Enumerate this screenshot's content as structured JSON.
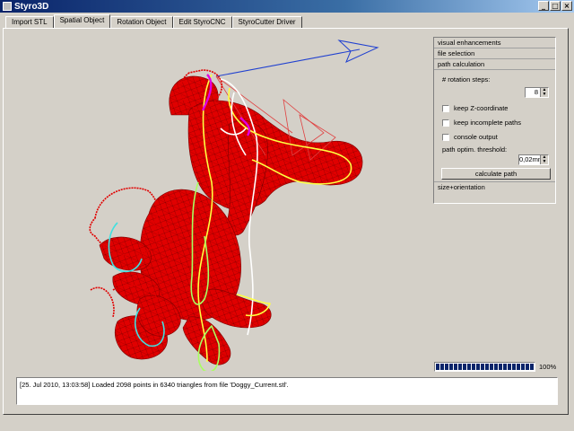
{
  "window": {
    "title": "Styro3D",
    "buttons": {
      "minimize": "_",
      "maximize": "□",
      "close": "×"
    }
  },
  "tabs": [
    {
      "label": "Import STL",
      "active": false
    },
    {
      "label": "Spatial Object",
      "active": true
    },
    {
      "label": "Rotation Object",
      "active": false
    },
    {
      "label": "Edit StyroCNC",
      "active": false
    },
    {
      "label": "StyroCutter Driver",
      "active": false
    }
  ],
  "viewport": {
    "description_icon": "3d-model-viewport",
    "colors": {
      "mesh": "#e00000",
      "mesh_edge": "#8a0000",
      "axis_blue": "#2040d0",
      "axis_red": "#e04040"
    }
  },
  "panel": {
    "sections": {
      "visual": "visual enhancements",
      "file": "file selection",
      "path": "path calculation",
      "size": "size+orientation"
    },
    "rotation_steps_label": "# rotation steps:",
    "rotation_steps_value": "8",
    "checkboxes": {
      "keep_z": "keep Z-coordinate",
      "keep_incomplete": "keep incomplete paths",
      "console": "console output"
    },
    "threshold_label": "path optim. threshold:",
    "threshold_value": "0,02mm",
    "calculate_button": "calculate path"
  },
  "progress": {
    "value": 1.0,
    "label": "100%"
  },
  "log": {
    "line": "[25. Jul 2010, 13:03:58]  Loaded 2098 points in 6340 triangles from file 'Doggy_Current.stl'."
  }
}
